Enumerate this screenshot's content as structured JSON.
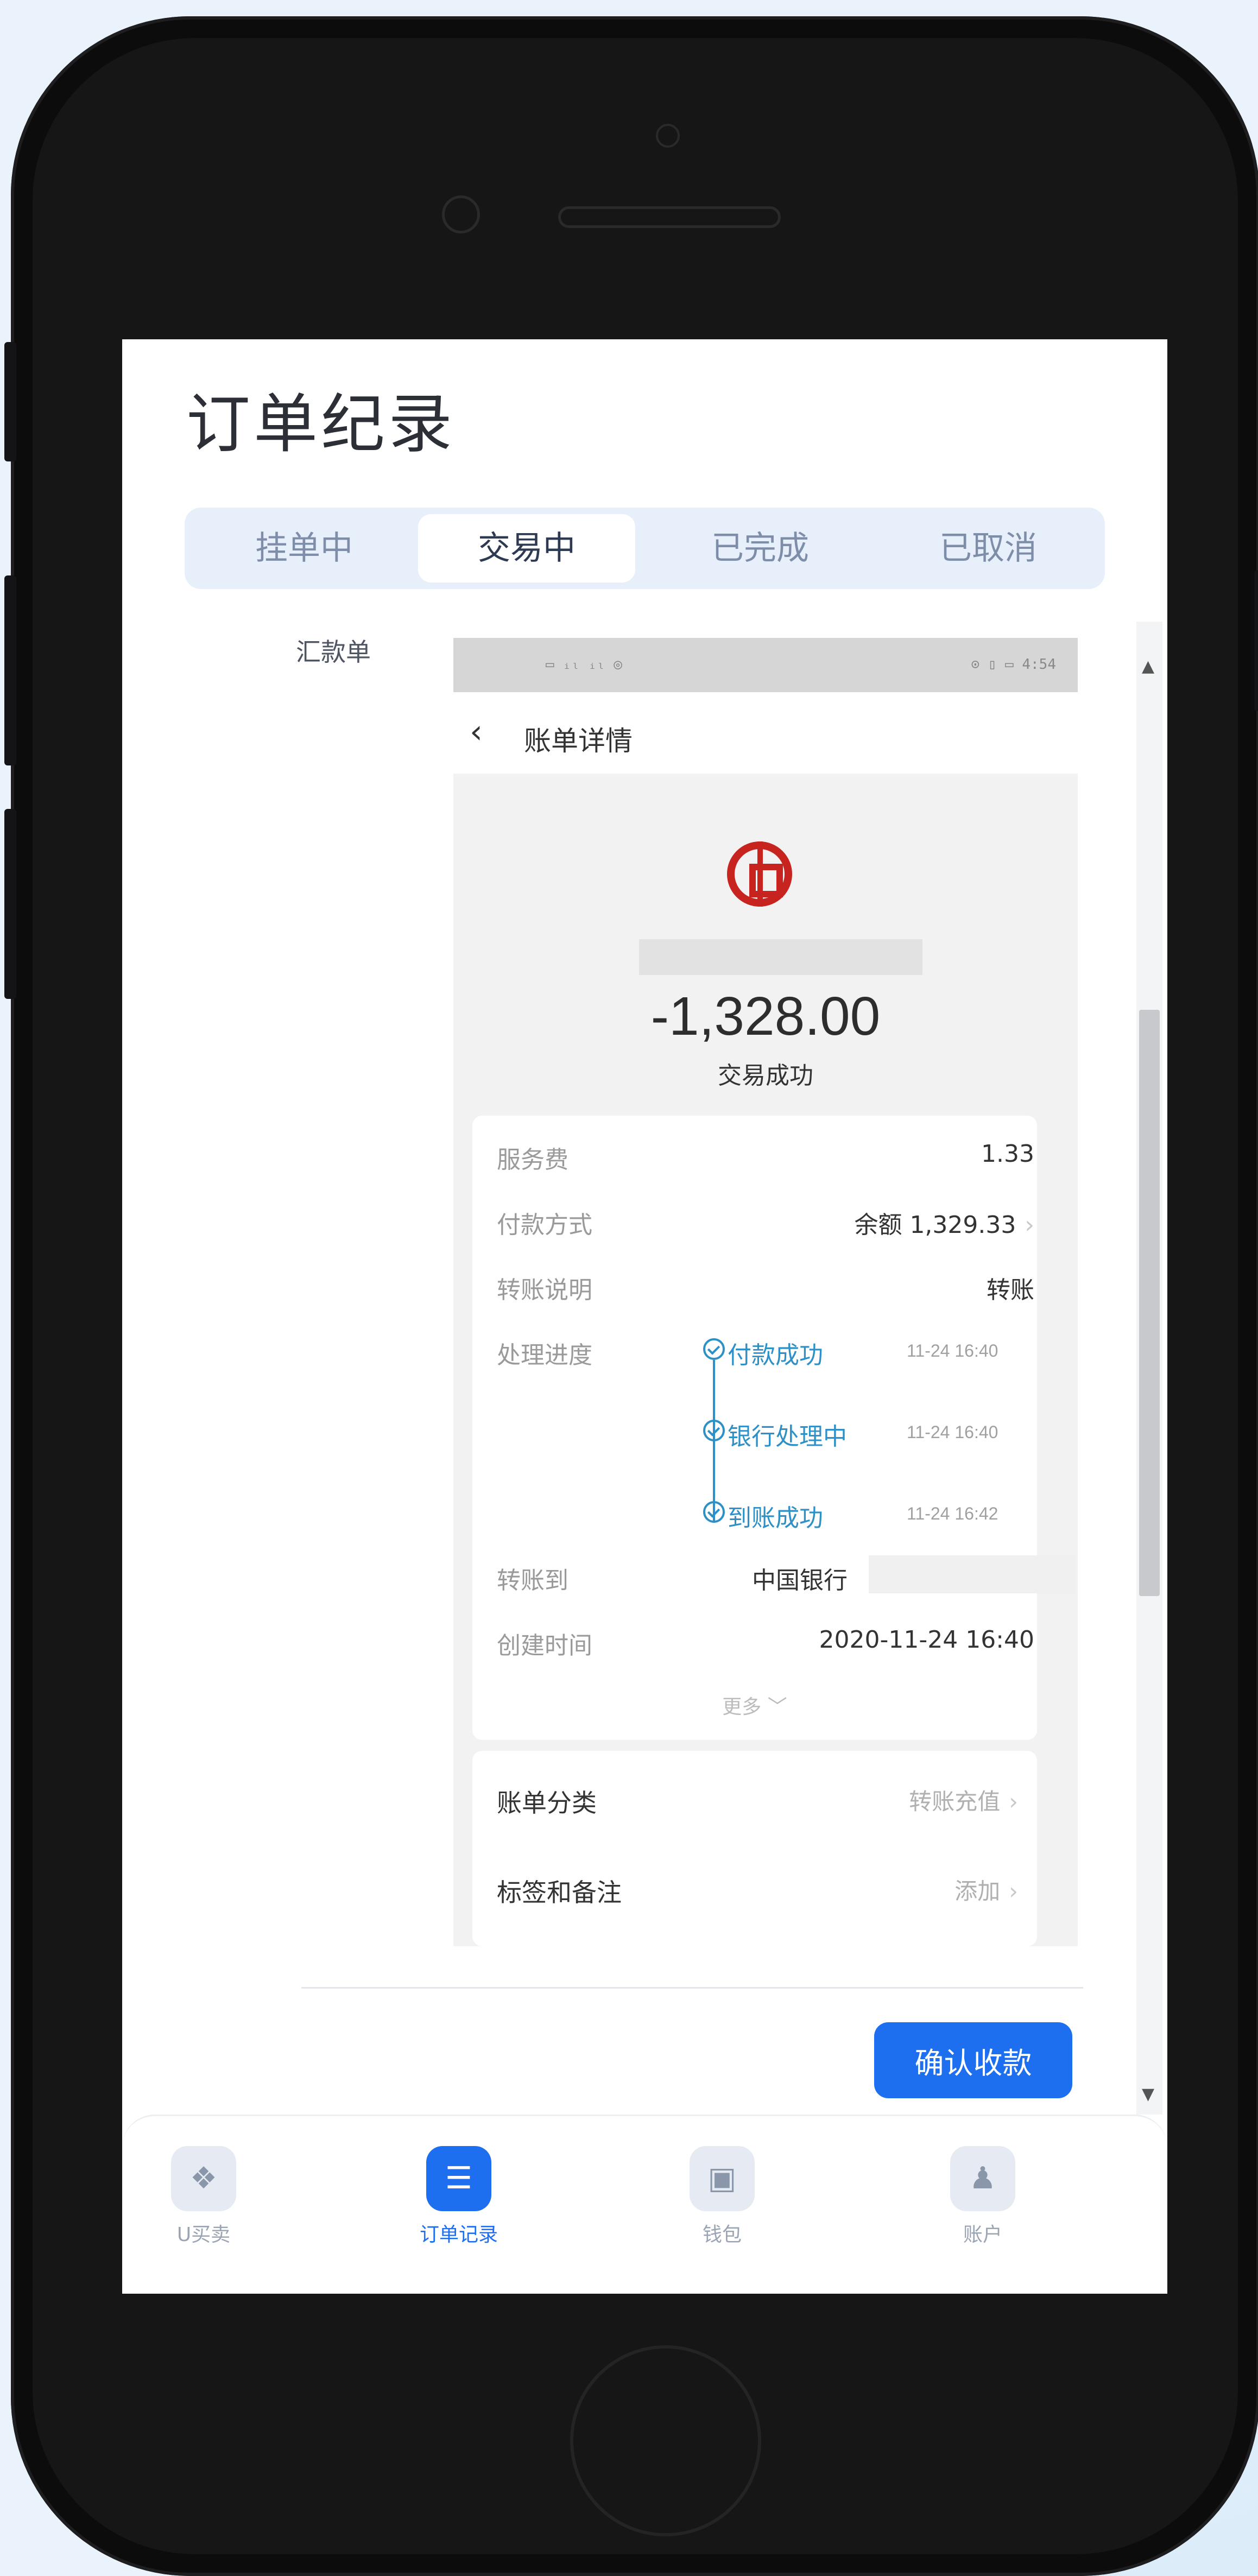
{
  "page": {
    "title": "订单纪录"
  },
  "tabs": [
    {
      "label": "挂单中"
    },
    {
      "label": "交易中"
    },
    {
      "label": "已完成"
    },
    {
      "label": "已取消"
    }
  ],
  "order": {
    "label": "汇款单",
    "confirm_label": "确认收款"
  },
  "receipt": {
    "status_time": "4:54",
    "status_left": "▭ ᵢₗ ᵢₗ ◎",
    "status_right": "⊙ ▯ ▭ 4:54",
    "back_icon": "‹",
    "nav_title": "账单详情",
    "amount": "-1,328.00",
    "amount_status": "交易成功",
    "rows": [
      {
        "key": "服务费",
        "value": "1.33"
      },
      {
        "key": "付款方式",
        "value": "余额 1,329.33"
      },
      {
        "key": "转账说明",
        "value": "转账"
      },
      {
        "key": "处理进度",
        "value": ""
      },
      {
        "key": "转账到",
        "value": "中国银行"
      },
      {
        "key": "创建时间",
        "value": "2020-11-24 16:40"
      }
    ],
    "steps": [
      {
        "name": "付款成功",
        "time": "11-24 16:40"
      },
      {
        "name": "银行处理中",
        "time": "11-24 16:40"
      },
      {
        "name": "到账成功",
        "time": "11-24 16:42"
      }
    ],
    "more": "更多 ﹀",
    "extras": [
      {
        "key": "账单分类",
        "value": "转账充值"
      },
      {
        "key": "标签和备注",
        "value": "添加"
      }
    ]
  },
  "bottom_nav": [
    {
      "label": "U买卖",
      "icon": "diamond-icon",
      "glyph": "❖"
    },
    {
      "label": "订单记录",
      "icon": "list-icon",
      "glyph": "☰"
    },
    {
      "label": "钱包",
      "icon": "wallet-icon",
      "glyph": "▣"
    },
    {
      "label": "账户",
      "icon": "user-icon",
      "glyph": "♟"
    }
  ],
  "colors": {
    "accent": "#1e6ff0",
    "step_blue": "#2d90c6",
    "bank_red": "#c8241f"
  }
}
